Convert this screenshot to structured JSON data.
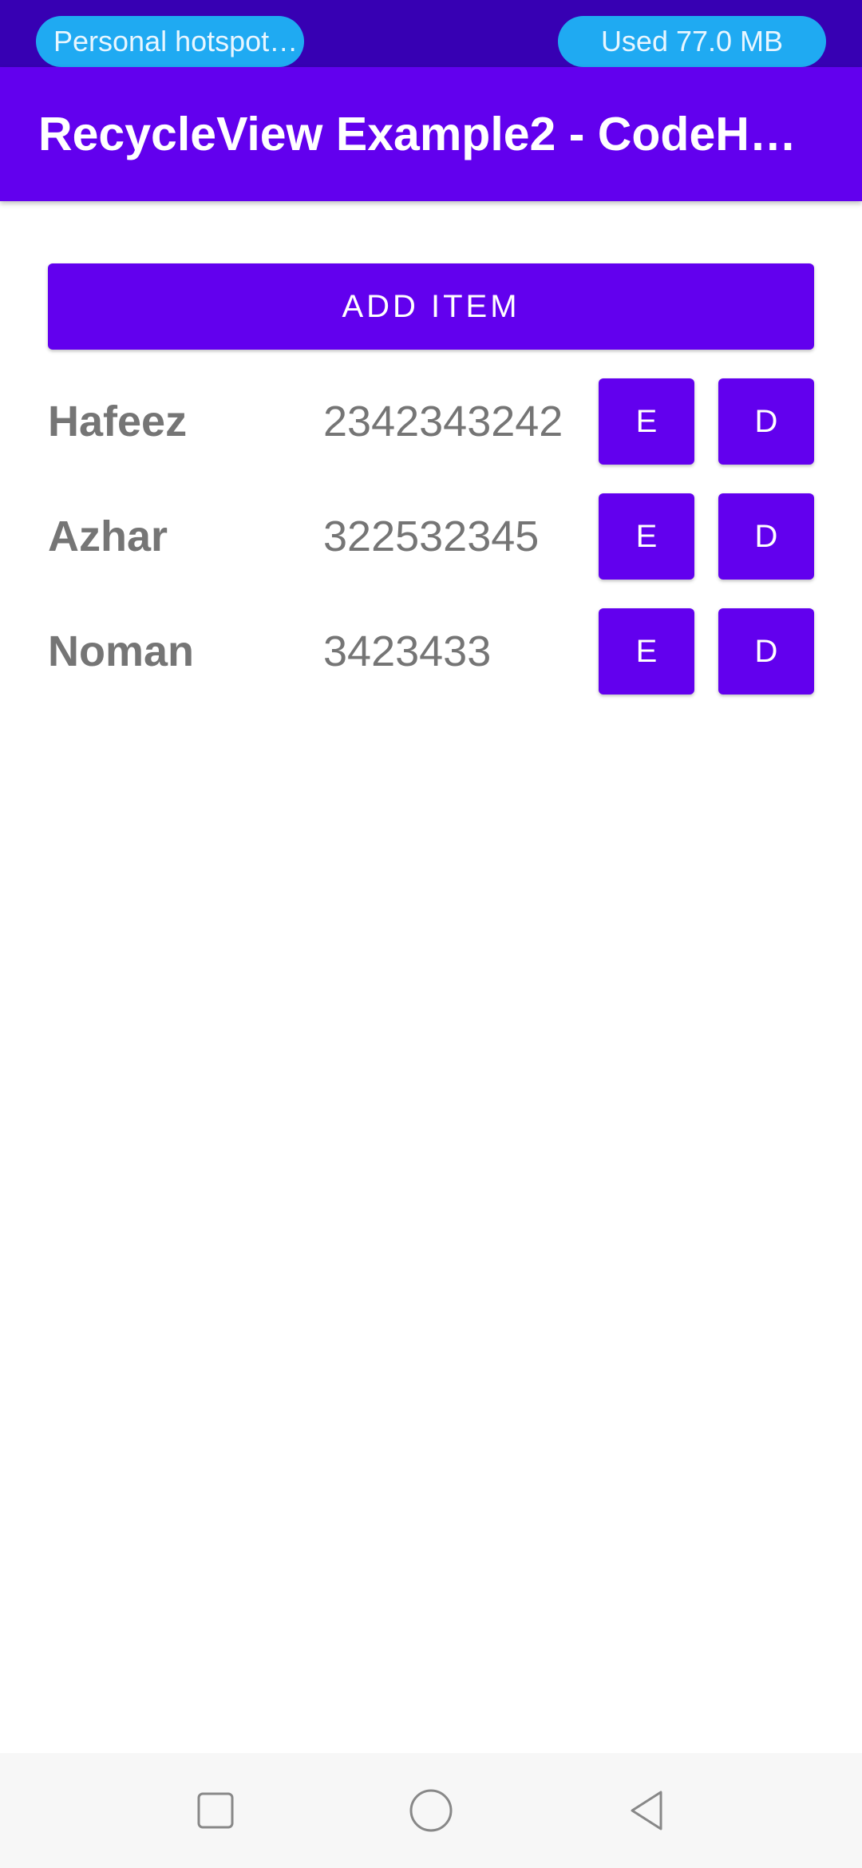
{
  "status_bar": {
    "hotspot_label": "Personal hotspot ...",
    "data_usage": "Used  77.0 MB"
  },
  "app_bar": {
    "title": "RecycleView Example2 - CodeHa…"
  },
  "add_button_label": "ADD ITEM",
  "items": [
    {
      "name": "Hafeez",
      "phone": "2342343242",
      "edit_label": "E",
      "delete_label": "D"
    },
    {
      "name": "Azhar",
      "phone": "322532345",
      "edit_label": "E",
      "delete_label": "D"
    },
    {
      "name": "Noman",
      "phone": "3423433",
      "edit_label": "E",
      "delete_label": "D"
    }
  ],
  "nav_bar": {
    "buttons": [
      "recents-icon",
      "home-icon",
      "back-icon"
    ]
  },
  "colors": {
    "primary": "#6200ee",
    "primary_dark": "#3700b3",
    "pill": "#1faaf2",
    "text_gray": "#757575",
    "nav_bg": "#f7f7f7"
  }
}
